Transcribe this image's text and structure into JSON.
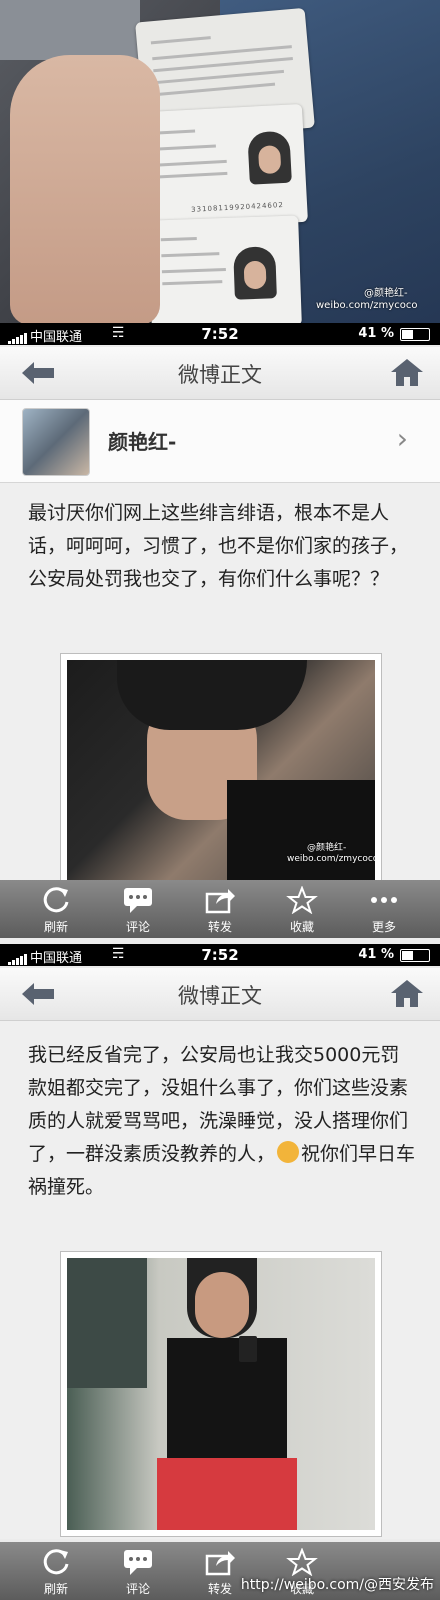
{
  "photo": {
    "watermark_handle": "@颜艳红-",
    "watermark_url": "weibo.com/zmycoco",
    "id_number": "33108119920424602"
  },
  "status": {
    "carrier": "中国联通",
    "time": "7:52",
    "battery": "41 %"
  },
  "nav": {
    "title": "微博正文"
  },
  "user": {
    "name": "颜艳红-"
  },
  "post1": {
    "text": "最讨厌你们网上这些绯言绯语，根本不是人话，呵呵呵，习惯了，也不是你们家的孩子，公安局处罚我也交了，有你们什么事呢？？",
    "img_watermark_handle": "@颜艳红-",
    "img_watermark_url": "weibo.com/zmycoco"
  },
  "toolbar": {
    "refresh": "刷新",
    "comment": "评论",
    "repost": "转发",
    "favorite": "收藏",
    "more": "更多"
  },
  "post2": {
    "text_before_emoji": "我已经反省完了，公安局也让我交5000元罚款姐都交完了，没姐什么事了，你们这些没素质的人就爱骂骂吧，洗澡睡觉，没人搭理你们了，一群没素质没教养的人，",
    "text_after_emoji": "祝你们早日车祸撞死。"
  },
  "footer": {
    "watermark": "http://weibo.com/@西安发布"
  }
}
